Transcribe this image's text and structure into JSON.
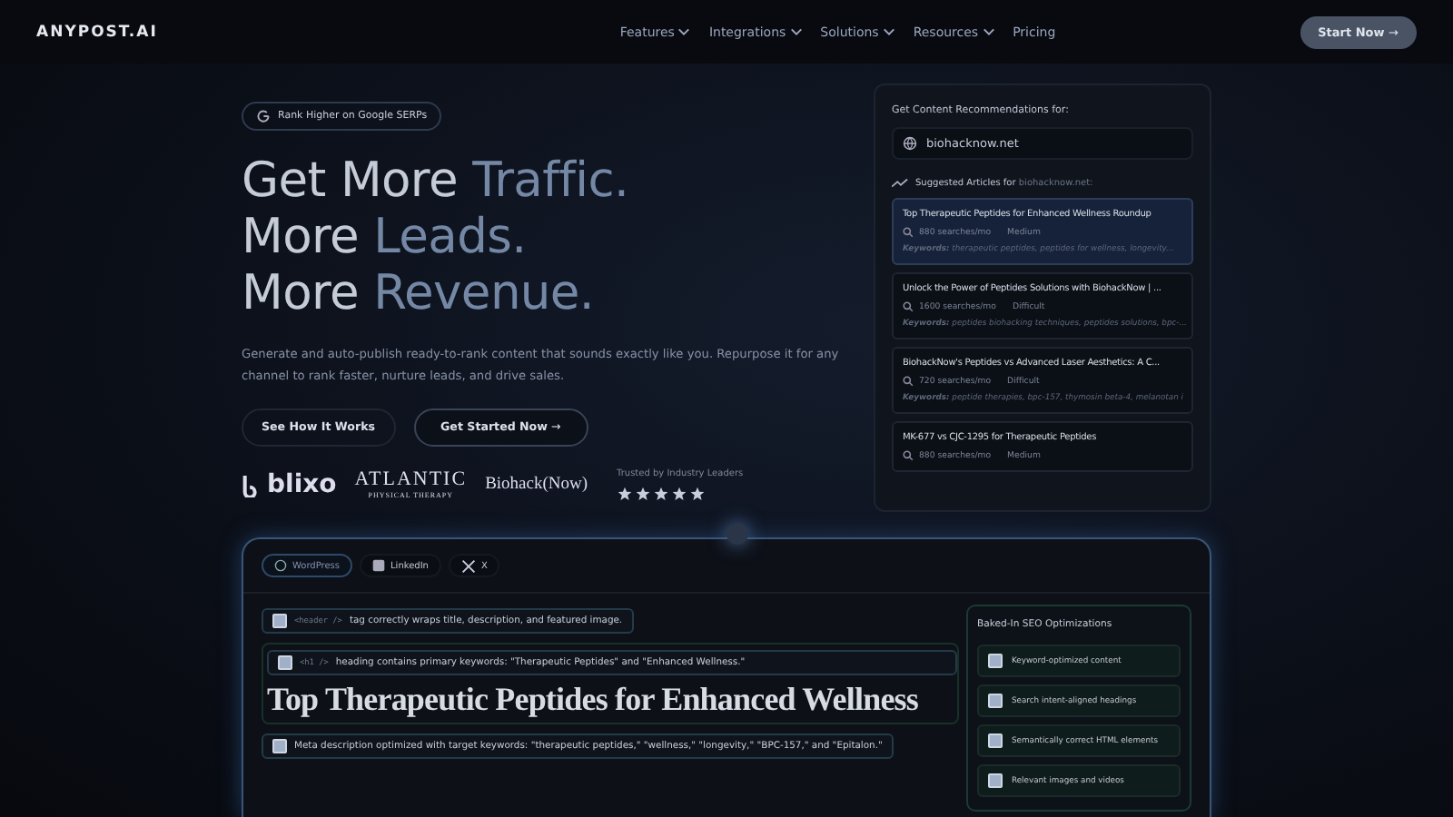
{
  "nav": {
    "logo": "ANYPOST.AI",
    "links": [
      {
        "label": "Features",
        "dropdown": true
      },
      {
        "label": "Integrations",
        "dropdown": true
      },
      {
        "label": "Solutions",
        "dropdown": true
      },
      {
        "label": "Resources",
        "dropdown": true
      },
      {
        "label": "Pricing",
        "dropdown": false
      }
    ],
    "cta": "Start Now",
    "cta_arrow": "→"
  },
  "hero": {
    "badge": "Rank Higher on Google SERPs",
    "headline": [
      {
        "text": "Get More ",
        "accent": "Traffic."
      },
      {
        "text": "More ",
        "accent": "Leads."
      },
      {
        "text": "More ",
        "accent": "Revenue."
      }
    ],
    "subtitle": "Generate and auto-publish ready-to-rank content that sounds exactly like you. Repurpose it for any channel to rank faster, nurture leads, and drive sales.",
    "buttons": [
      {
        "label": "See How It Works",
        "kind": "outline"
      },
      {
        "label": "Get Started Now",
        "kind": "primary",
        "arrow": "→"
      }
    ],
    "logos": [
      {
        "kind": "blixo",
        "text": "blixo"
      },
      {
        "kind": "atlantic",
        "text": "ATLANTIC",
        "sub": "PHYSICAL THERAPY"
      },
      {
        "kind": "biohack",
        "text": "Biohack(Now)"
      }
    ],
    "trusted": "Trusted by Industry Leaders",
    "stars": 5
  },
  "recommend": {
    "label": "Get Content Recommendations for:",
    "domain": "biohacknow.net",
    "suggested": "Suggested Articles for ",
    "suggested_domain": "biohacknow.net:",
    "articles": [
      {
        "title": "Top Therapeutic Peptides for Enhanced Wellness Roundup",
        "searches": "880 searches/mo",
        "difficulty": "Medium",
        "keywords": "**Keywords:** therapeutic peptides, peptides for wellness, longevity...",
        "selected": true
      },
      {
        "title": "Unlock the Power of Peptides Solutions with BiohackNow | ...",
        "searches": "1600 searches/mo",
        "difficulty": "Difficult",
        "keywords": "**Keywords:** peptides biohacking techniques, peptides solutions, bpc-...",
        "selected": false
      },
      {
        "title": "BiohackNow's Peptides vs Advanced Laser Aesthetics: A C...",
        "searches": "720 searches/mo",
        "difficulty": "Difficult",
        "keywords": "**Keywords:** peptide therapies, bpc-157, thymosin beta-4, melanotan i",
        "selected": false
      },
      {
        "title": "MK-677 vs CJC-1295 for Therapeutic Peptides",
        "searches": "880 searches/mo",
        "difficulty": "Medium",
        "selected": false
      }
    ]
  },
  "preview": {
    "tabs": [
      {
        "label": "WordPress",
        "kind": "wordpress",
        "selected": true
      },
      {
        "label": "LinkedIn",
        "kind": "linkedin",
        "selected": false
      },
      {
        "label": "X",
        "kind": "x",
        "selected": false
      }
    ],
    "checks": [
      {
        "tag": "<header />",
        "text": "tag correctly wraps title, description, and featured image.",
        "checked": true
      },
      {
        "tag": "<h1 />",
        "text": "heading contains primary keywords: \"Therapeutic Peptides\" and \"Enhanced Wellness.\"",
        "checked": true
      },
      {
        "text": "Meta description optimized with target keywords: \"therapeutic peptides,\" \"wellness,\" \"longevity,\" \"BPC-157,\" and \"Epitalon.\"",
        "checked": true
      }
    ],
    "heading": "Top Therapeutic Peptides for Enhanced Wellness",
    "seo_title": "Baked-In SEO Optimizations",
    "seo_items": [
      {
        "label": "Keyword-optimized content",
        "checked": true
      },
      {
        "label": "Search intent-aligned headings",
        "checked": true
      },
      {
        "label": "Semantically correct HTML elements",
        "checked": true
      },
      {
        "label": "Relevant images and videos",
        "checked": true
      }
    ]
  }
}
